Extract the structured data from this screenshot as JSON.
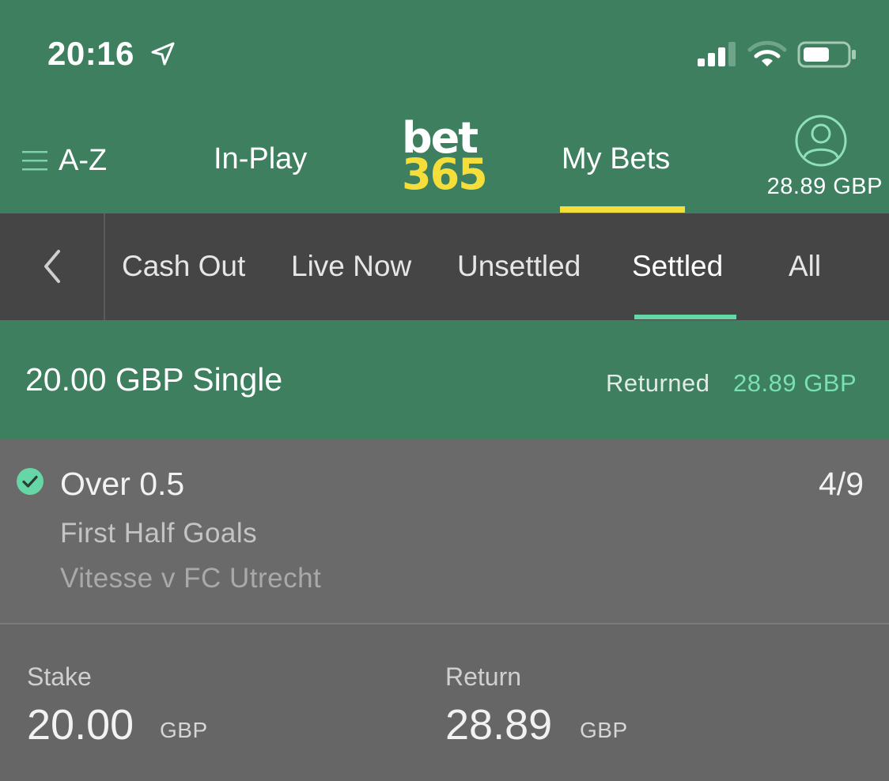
{
  "status_bar": {
    "time": "20:16",
    "icons": [
      "location-arrow-icon",
      "cellular-signal-icon",
      "wifi-icon",
      "battery-icon"
    ]
  },
  "header": {
    "menu_label": "A-Z",
    "inplay_label": "In-Play",
    "logo_top": "bet",
    "logo_bottom": "365",
    "mybets_label": "My Bets",
    "balance": "28.89 GBP"
  },
  "subtabs": {
    "items": [
      "Cash Out",
      "Live Now",
      "Unsettled",
      "Settled",
      "All"
    ],
    "active": "Settled"
  },
  "bet": {
    "title": "20.00 GBP Single",
    "returned_label": "Returned",
    "returned_amount": "28.89 GBP",
    "selection": {
      "name": "Over 0.5",
      "odds": "4/9",
      "market": "First Half Goals",
      "event": "Vitesse v FC Utrecht"
    },
    "stake_label": "Stake",
    "stake_value": "20.00",
    "stake_currency": "GBP",
    "return_label": "Return",
    "return_value": "28.89",
    "return_currency": "GBP"
  },
  "colors": {
    "header_green": "#3d7f5e",
    "brand_yellow": "#f6de3a",
    "accent_mint": "#66d6a6",
    "subtab_bar": "#454545",
    "card_grey": "#6a6a6a"
  }
}
